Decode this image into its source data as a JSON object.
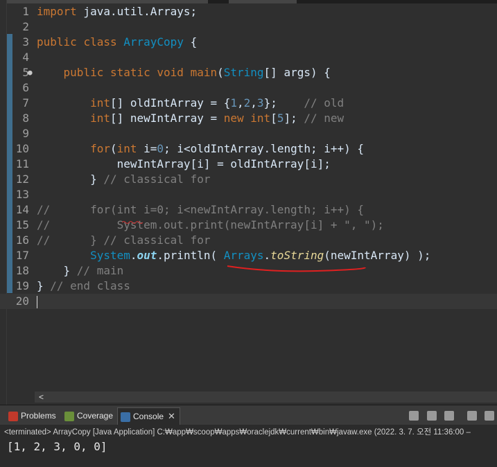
{
  "editor": {
    "lines": [
      {
        "n": "1",
        "seg": [
          {
            "t": "import",
            "c": "kw"
          },
          {
            "t": " java.util.Arrays;"
          }
        ]
      },
      {
        "n": "2",
        "seg": []
      },
      {
        "n": "3",
        "seg": [
          {
            "t": "public",
            "c": "kw"
          },
          {
            "t": " "
          },
          {
            "t": "class",
            "c": "kw"
          },
          {
            "t": " "
          },
          {
            "t": "ArrayCopy",
            "c": "cls"
          },
          {
            "t": " {"
          }
        ]
      },
      {
        "n": "4",
        "seg": []
      },
      {
        "n": "5",
        "fold": true,
        "seg": [
          {
            "t": "    "
          },
          {
            "t": "public",
            "c": "kw"
          },
          {
            "t": " "
          },
          {
            "t": "static",
            "c": "kw"
          },
          {
            "t": " "
          },
          {
            "t": "void",
            "c": "kw"
          },
          {
            "t": " "
          },
          {
            "t": "main",
            "c": "kw"
          },
          {
            "t": "("
          },
          {
            "t": "String",
            "c": "cls"
          },
          {
            "t": "[] args) {"
          }
        ]
      },
      {
        "n": "6",
        "seg": []
      },
      {
        "n": "7",
        "seg": [
          {
            "t": "        "
          },
          {
            "t": "int",
            "c": "kw"
          },
          {
            "t": "[] oldIntArray = {"
          },
          {
            "t": "1",
            "c": "num"
          },
          {
            "t": ","
          },
          {
            "t": "2",
            "c": "num"
          },
          {
            "t": ","
          },
          {
            "t": "3",
            "c": "num"
          },
          {
            "t": "};    "
          },
          {
            "t": "// old",
            "c": "cm"
          }
        ]
      },
      {
        "n": "8",
        "seg": [
          {
            "t": "        "
          },
          {
            "t": "int",
            "c": "kw"
          },
          {
            "t": "[] newIntArray = "
          },
          {
            "t": "new",
            "c": "kw"
          },
          {
            "t": " "
          },
          {
            "t": "int",
            "c": "kw"
          },
          {
            "t": "["
          },
          {
            "t": "5",
            "c": "num"
          },
          {
            "t": "]; "
          },
          {
            "t": "// new",
            "c": "cm"
          }
        ]
      },
      {
        "n": "9",
        "seg": []
      },
      {
        "n": "10",
        "seg": [
          {
            "t": "        "
          },
          {
            "t": "for",
            "c": "kw"
          },
          {
            "t": "("
          },
          {
            "t": "int",
            "c": "kw"
          },
          {
            "t": " i="
          },
          {
            "t": "0",
            "c": "num"
          },
          {
            "t": "; i<oldIntArray.length; i++) {"
          }
        ]
      },
      {
        "n": "11",
        "seg": [
          {
            "t": "            newIntArray[i] = oldIntArray[i];"
          }
        ]
      },
      {
        "n": "12",
        "seg": [
          {
            "t": "        } "
          },
          {
            "t": "// classical for",
            "c": "cm"
          }
        ]
      },
      {
        "n": "13",
        "seg": []
      },
      {
        "n": "14",
        "seg": [
          {
            "t": "//      for(int i=0; i<newIntArray.length; i++) {",
            "c": "cm"
          }
        ]
      },
      {
        "n": "15",
        "seg": [
          {
            "t": "//          System.out.print(newIntArray[i] + \", \");",
            "c": "cm"
          }
        ]
      },
      {
        "n": "16",
        "seg": [
          {
            "t": "//      } // classical for",
            "c": "cm"
          }
        ]
      },
      {
        "n": "17",
        "seg": [
          {
            "t": "        "
          },
          {
            "t": "System",
            "c": "cls"
          },
          {
            "t": "."
          },
          {
            "t": "out",
            "c": "out"
          },
          {
            "t": ".println( "
          },
          {
            "t": "Arrays",
            "c": "cls"
          },
          {
            "t": "."
          },
          {
            "t": "toString",
            "c": "meth"
          },
          {
            "t": "(newIntArray) );"
          }
        ]
      },
      {
        "n": "18",
        "seg": [
          {
            "t": "    } "
          },
          {
            "t": "// main",
            "c": "cm"
          }
        ]
      },
      {
        "n": "19",
        "seg": [
          {
            "t": "} "
          },
          {
            "t": "// end class",
            "c": "cm"
          }
        ]
      },
      {
        "n": "20",
        "current": true,
        "seg": []
      }
    ],
    "hscroll_arrow": "<"
  },
  "console": {
    "tabs": [
      {
        "label": "Problems",
        "icon": "problems-icon",
        "color": "#c0392b"
      },
      {
        "label": "Coverage",
        "icon": "coverage-icon",
        "color": "#6a8f3a"
      },
      {
        "label": "Console",
        "icon": "console-icon",
        "color": "#3a6ea5",
        "active": true,
        "close": "✕"
      }
    ],
    "status": "<terminated> ArrayCopy [Java Application] C:₩app₩scoop₩apps₩oraclejdk₩current₩bin₩javaw.exe  (2022. 3. 7. 오전 11:36:00 –",
    "output": "[1, 2, 3, 0, 0]"
  }
}
